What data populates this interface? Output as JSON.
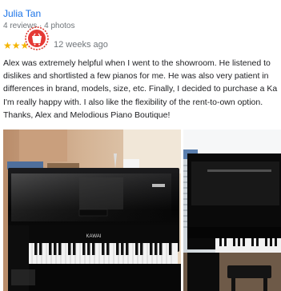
{
  "review": {
    "reviewer_name": "Julia Tan",
    "reviewer_meta": "4 reviews · 4 photos",
    "rating": 3,
    "max_rating": 5,
    "time_ago": "12 weeks ago",
    "text_lines": [
      "Alex was extremely helpful when I went to the showroom. He listened to",
      "dislikes and shortlisted a few pianos for me. He was also very patient in",
      "differences in brand, models, size, etc. Finally, I decided to purchase a Ka",
      "I'm really happy with. I also like the flexibility of the rent-to-own option.",
      "Thanks, Alex and Melodious Piano Boutique!"
    ],
    "photos": [
      {
        "brand": "KAWAI",
        "icon": "piano-photo"
      },
      {
        "brand": "",
        "icon": "piano-photo"
      }
    ]
  },
  "colors": {
    "link": "#1a73e8",
    "star": "#f4b400",
    "muted": "#70757a",
    "badge_red": "#d93025"
  }
}
